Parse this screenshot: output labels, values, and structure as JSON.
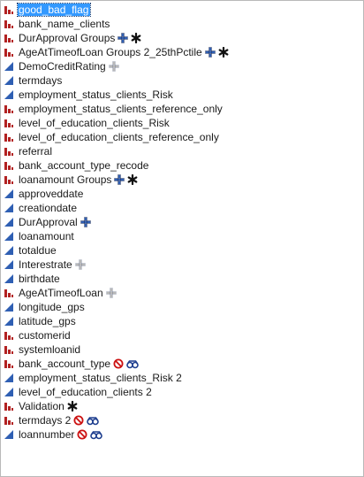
{
  "columns": [
    {
      "name": "good_bad_flag",
      "type": "nominal",
      "selected": true,
      "badges": []
    },
    {
      "name": "bank_name_clients",
      "type": "nominal",
      "badges": []
    },
    {
      "name": "DurApproval Groups",
      "type": "nominal",
      "badges": [
        "formula-blue-icon",
        "asterisk-icon"
      ]
    },
    {
      "name": "AgeAtTimeofLoan Groups 2_25thPctile",
      "type": "nominal",
      "badges": [
        "formula-blue-icon",
        "asterisk-icon"
      ]
    },
    {
      "name": "DemoCreditRating",
      "type": "continuous",
      "badges": [
        "formula-gray-icon"
      ]
    },
    {
      "name": "termdays",
      "type": "continuous",
      "badges": []
    },
    {
      "name": "employment_status_clients_Risk",
      "type": "continuous",
      "badges": []
    },
    {
      "name": "employment_status_clients_reference_only",
      "type": "nominal",
      "badges": []
    },
    {
      "name": "level_of_education_clients_Risk",
      "type": "nominal",
      "badges": []
    },
    {
      "name": "level_of_education_clients_reference_only",
      "type": "nominal",
      "badges": []
    },
    {
      "name": "referral",
      "type": "nominal",
      "badges": []
    },
    {
      "name": "bank_account_type_recode",
      "type": "nominal",
      "badges": []
    },
    {
      "name": "loanamount Groups",
      "type": "nominal",
      "badges": [
        "formula-blue-icon",
        "asterisk-icon"
      ]
    },
    {
      "name": "approveddate",
      "type": "continuous",
      "badges": []
    },
    {
      "name": "creationdate",
      "type": "continuous",
      "badges": []
    },
    {
      "name": "DurApproval",
      "type": "continuous",
      "badges": [
        "formula-blue-icon"
      ]
    },
    {
      "name": "loanamount",
      "type": "continuous",
      "badges": []
    },
    {
      "name": "totaldue",
      "type": "continuous",
      "badges": []
    },
    {
      "name": "Interestrate",
      "type": "continuous",
      "badges": [
        "formula-gray-icon"
      ]
    },
    {
      "name": "birthdate",
      "type": "continuous",
      "badges": []
    },
    {
      "name": "AgeAtTimeofLoan",
      "type": "nominal",
      "badges": [
        "formula-gray-icon"
      ]
    },
    {
      "name": "longitude_gps",
      "type": "continuous",
      "badges": []
    },
    {
      "name": "latitude_gps",
      "type": "continuous",
      "badges": []
    },
    {
      "name": "customerid",
      "type": "nominal",
      "badges": []
    },
    {
      "name": "systemloanid",
      "type": "nominal",
      "badges": []
    },
    {
      "name": "bank_account_type",
      "type": "nominal",
      "badges": [
        "excluded-icon",
        "hidden-icon"
      ]
    },
    {
      "name": "employment_status_clients_Risk 2",
      "type": "continuous",
      "badges": []
    },
    {
      "name": "level_of_education_clients 2",
      "type": "continuous",
      "badges": []
    },
    {
      "name": "Validation",
      "type": "nominal",
      "badges": [
        "asterisk-icon"
      ]
    },
    {
      "name": "termdays 2",
      "type": "nominal",
      "badges": [
        "excluded-icon",
        "hidden-icon"
      ]
    },
    {
      "name": "loannumber",
      "type": "continuous",
      "badges": [
        "excluded-icon",
        "hidden-icon"
      ]
    }
  ],
  "colors": {
    "nominal": "#b22222",
    "continuous": "#2f5fb3",
    "selection": "#3399ff",
    "formula_blue": "#2f5fb3",
    "formula_gray": "#b8b8b8",
    "excluded": "#cc1111",
    "hidden": "#1f3f8f"
  }
}
